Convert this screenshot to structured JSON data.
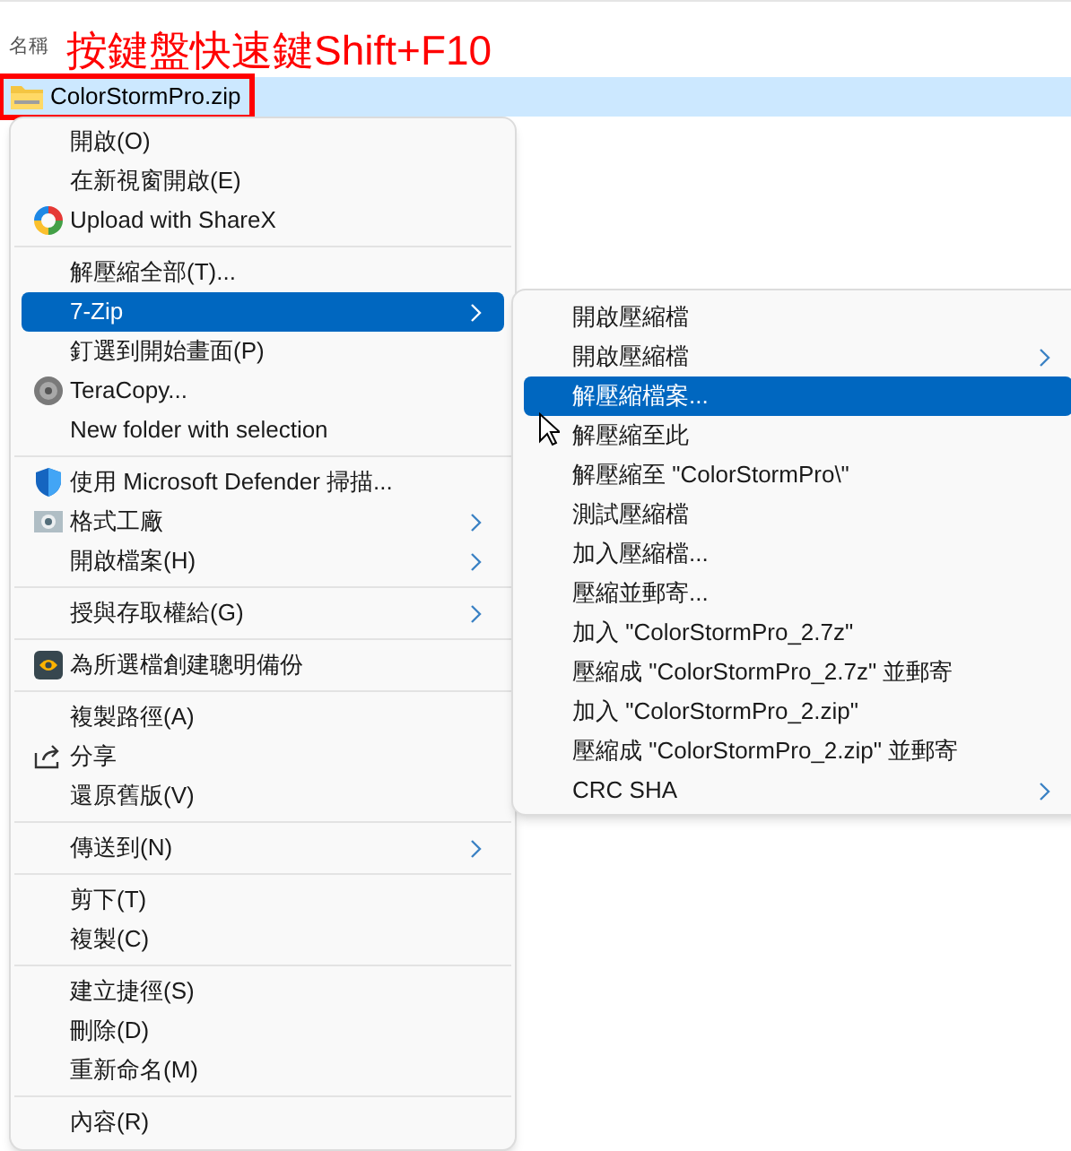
{
  "column_header": "名稱",
  "annotation": "按鍵盤快速鍵Shift+F10",
  "file": {
    "name": "ColorStormPro.zip",
    "selected": true
  },
  "context_menu": {
    "items": [
      {
        "kind": "item",
        "label": "開啟(O)",
        "submenu": false,
        "selected": false
      },
      {
        "kind": "item",
        "label": "在新視窗開啟(E)",
        "submenu": false,
        "selected": false
      },
      {
        "kind": "item",
        "label": "Upload with ShareX",
        "submenu": false,
        "selected": false
      },
      {
        "kind": "separator"
      },
      {
        "kind": "item",
        "label": "解壓縮全部(T)...",
        "submenu": false,
        "selected": false
      },
      {
        "kind": "item",
        "label": "7-Zip",
        "submenu": true,
        "selected": true
      },
      {
        "kind": "item",
        "label": "釘選到開始畫面(P)",
        "submenu": false,
        "selected": false
      },
      {
        "kind": "item",
        "label": "TeraCopy...",
        "submenu": false,
        "selected": false
      },
      {
        "kind": "item",
        "label": "New folder with selection",
        "submenu": false,
        "selected": false
      },
      {
        "kind": "separator"
      },
      {
        "kind": "item",
        "label": "使用 Microsoft Defender 掃描...",
        "submenu": false,
        "selected": false
      },
      {
        "kind": "item",
        "label": "格式工廠",
        "submenu": true,
        "selected": false
      },
      {
        "kind": "item",
        "label": "開啟檔案(H)",
        "submenu": true,
        "selected": false
      },
      {
        "kind": "separator"
      },
      {
        "kind": "item",
        "label": "授與存取權給(G)",
        "submenu": true,
        "selected": false
      },
      {
        "kind": "separator"
      },
      {
        "kind": "item",
        "label": "為所選檔創建聰明備份",
        "submenu": false,
        "selected": false
      },
      {
        "kind": "separator"
      },
      {
        "kind": "item",
        "label": "複製路徑(A)",
        "submenu": false,
        "selected": false
      },
      {
        "kind": "item",
        "label": "分享",
        "submenu": false,
        "selected": false
      },
      {
        "kind": "item",
        "label": "還原舊版(V)",
        "submenu": false,
        "selected": false
      },
      {
        "kind": "separator"
      },
      {
        "kind": "item",
        "label": "傳送到(N)",
        "submenu": true,
        "selected": false
      },
      {
        "kind": "separator"
      },
      {
        "kind": "item",
        "label": "剪下(T)",
        "submenu": false,
        "selected": false
      },
      {
        "kind": "item",
        "label": "複製(C)",
        "submenu": false,
        "selected": false
      },
      {
        "kind": "separator"
      },
      {
        "kind": "item",
        "label": "建立捷徑(S)",
        "submenu": false,
        "selected": false
      },
      {
        "kind": "item",
        "label": "刪除(D)",
        "submenu": false,
        "selected": false
      },
      {
        "kind": "item",
        "label": "重新命名(M)",
        "submenu": false,
        "selected": false
      },
      {
        "kind": "separator"
      },
      {
        "kind": "item",
        "label": "內容(R)",
        "submenu": false,
        "selected": false
      }
    ]
  },
  "submenu": {
    "items": [
      {
        "kind": "item",
        "label": "開啟壓縮檔",
        "submenu": false,
        "selected": false
      },
      {
        "kind": "item",
        "label": "開啟壓縮檔",
        "submenu": true,
        "selected": false
      },
      {
        "kind": "item",
        "label": "解壓縮檔案...",
        "submenu": false,
        "selected": true
      },
      {
        "kind": "item",
        "label": "解壓縮至此",
        "submenu": false,
        "selected": false
      },
      {
        "kind": "item",
        "label": "解壓縮至 \"ColorStormPro\\\"",
        "submenu": false,
        "selected": false
      },
      {
        "kind": "item",
        "label": "測試壓縮檔",
        "submenu": false,
        "selected": false
      },
      {
        "kind": "item",
        "label": "加入壓縮檔...",
        "submenu": false,
        "selected": false
      },
      {
        "kind": "item",
        "label": "壓縮並郵寄...",
        "submenu": false,
        "selected": false
      },
      {
        "kind": "item",
        "label": "加入 \"ColorStormPro_2.7z\"",
        "submenu": false,
        "selected": false
      },
      {
        "kind": "item",
        "label": "壓縮成 \"ColorStormPro_2.7z\" 並郵寄",
        "submenu": false,
        "selected": false
      },
      {
        "kind": "item",
        "label": "加入 \"ColorStormPro_2.zip\"",
        "submenu": false,
        "selected": false
      },
      {
        "kind": "item",
        "label": "壓縮成 \"ColorStormPro_2.zip\" 並郵寄",
        "submenu": false,
        "selected": false
      },
      {
        "kind": "item",
        "label": "CRC SHA",
        "submenu": true,
        "selected": false
      }
    ]
  }
}
